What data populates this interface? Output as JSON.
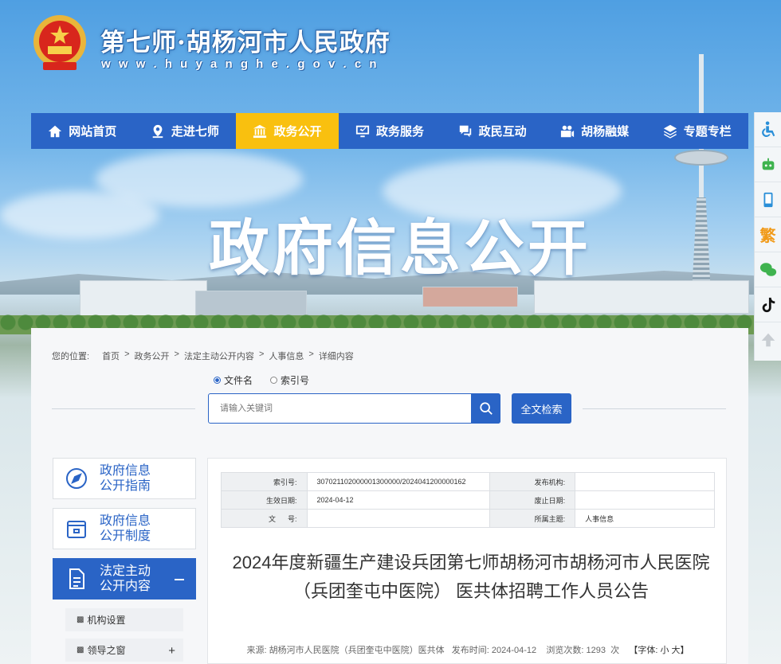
{
  "header": {
    "title": "第七师·胡杨河市人民政府",
    "url": "w w w . h u y a n g h e . g o v . c n"
  },
  "nav": {
    "items": [
      {
        "label": "网站首页",
        "icon": "home-icon",
        "active": false
      },
      {
        "label": "走进七师",
        "icon": "location-icon",
        "active": false
      },
      {
        "label": "政务公开",
        "icon": "government-building-icon",
        "active": true
      },
      {
        "label": "政务服务",
        "icon": "monitor-check-icon",
        "active": false
      },
      {
        "label": "政民互动",
        "icon": "chat-icon",
        "active": false
      },
      {
        "label": "胡杨融媒",
        "icon": "media-camera-icon",
        "active": false
      },
      {
        "label": "专题专栏",
        "icon": "layers-icon",
        "active": false
      }
    ]
  },
  "banner": {
    "title": "政府信息公开"
  },
  "sidebar_tools": [
    "accessibility-icon",
    "robot-icon",
    "mobile-icon",
    "traditional-chinese-icon",
    "wechat-icon",
    "tiktok-icon",
    "back-to-top-icon"
  ],
  "sidebar_tools_text": {
    "traditional": "繁"
  },
  "breadcrumb": {
    "prefix": "您的位置:",
    "items": [
      "首页",
      "政务公开",
      "法定主动公开内容",
      "人事信息",
      "详细内容"
    ]
  },
  "search": {
    "options": [
      "文件名",
      "索引号"
    ],
    "placeholder": "请输入关键词",
    "fulltext_label": "全文检索"
  },
  "sidemenu": {
    "items": [
      {
        "line1": "政府信息",
        "line2": "公开指南"
      },
      {
        "line1": "政府信息",
        "line2": "公开制度"
      },
      {
        "line1": "法定主动",
        "line2": "公开内容"
      }
    ],
    "subitems": [
      "机构设置",
      "领导之窗"
    ]
  },
  "article": {
    "meta": {
      "index_label": "索引号:",
      "index_value": "307021102000001300000/2024041200000162",
      "publisher_label": "发布机构:",
      "publisher_value": "",
      "effective_label": "生效日期:",
      "effective_value": "2024-04-12",
      "expire_label": "废止日期:",
      "expire_value": "",
      "docno_label": "文      号:",
      "docno_value": "",
      "topic_label": "所属主题:",
      "topic_value": "人事信息"
    },
    "title": "2024年度新疆生产建设兵团第七师胡杨河市胡杨河市人民医院（兵团奎屯中医院） 医共体招聘工作人员公告",
    "info": {
      "source_label": "来源:",
      "source_value": "胡杨河市人民医院（兵团奎屯中医院）医共体",
      "time_label": "发布时间:",
      "time_value": "2024-04-12",
      "views_label": "浏览次数:",
      "views_value": "1293",
      "views_unit": "次",
      "font_label": "【字体:",
      "font_small": "小",
      "font_large": "大",
      "font_end": "】"
    }
  }
}
